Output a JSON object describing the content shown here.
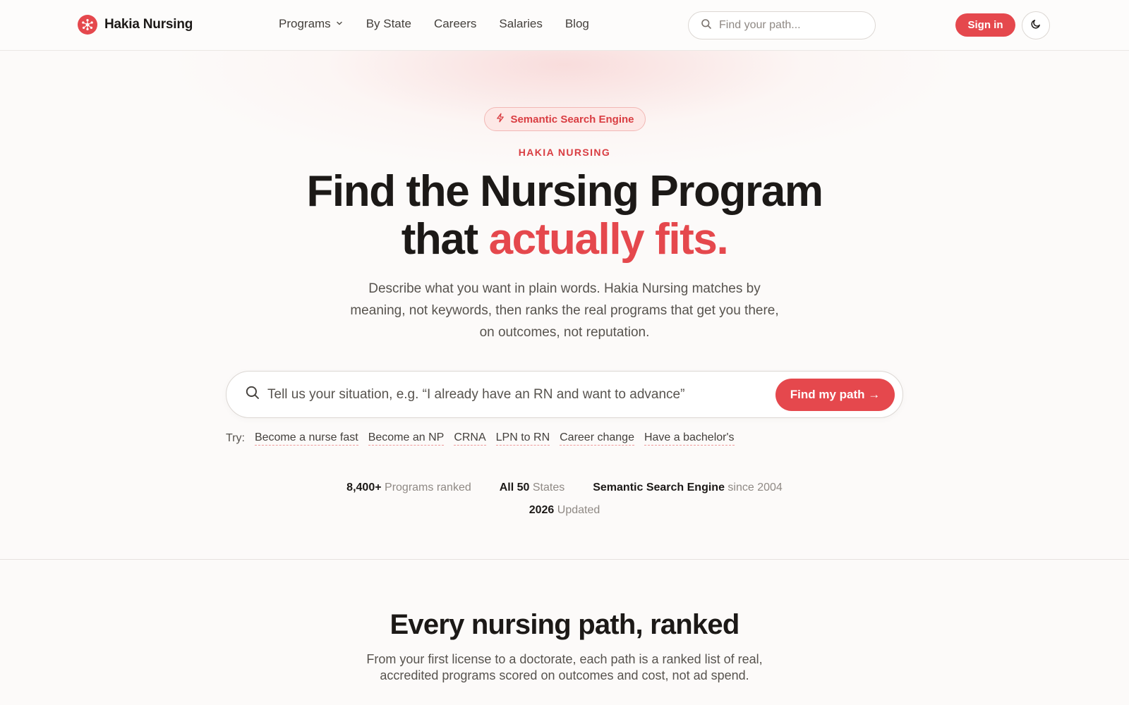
{
  "header": {
    "brand": "Hakia Nursing",
    "nav": [
      {
        "label": "Programs",
        "has_dropdown": true
      },
      {
        "label": "By State"
      },
      {
        "label": "Careers"
      },
      {
        "label": "Salaries"
      },
      {
        "label": "Blog"
      }
    ],
    "search_placeholder": "Find your path...",
    "signin_label": "Sign in",
    "theme_icon": "moon-icon"
  },
  "hero": {
    "badge": "Semantic Search Engine",
    "eyebrow": "HAKIA NURSING",
    "headline_line1": "Find the Nursing Program",
    "headline_line2_plain": "that ",
    "headline_line2_accent": "actually fits.",
    "subtext": "Describe what you want in plain words. Hakia Nursing matches by meaning, not keywords, then ranks the real programs that get you there, on outcomes, not reputation.",
    "search_placeholder": "Tell us your situation, e.g. “I already have an RN and want to advance”",
    "find_button": "Find my path →",
    "try_label": "Try:",
    "suggestions": [
      "Become a nurse fast",
      "Become an NP",
      "CRNA",
      "LPN to RN",
      "Career change",
      "Have a bachelor's"
    ],
    "stats": [
      {
        "value": "8,400+",
        "label": "Programs ranked"
      },
      {
        "value": "All 50",
        "label": "States"
      },
      {
        "value": "Semantic Search Engine",
        "label": "since 2004"
      },
      {
        "value": "2026",
        "label": "Updated"
      }
    ]
  },
  "section": {
    "title": "Every nursing path, ranked",
    "subtitle": "From your first license to a doctorate, each path is a ranked list of real, accredited programs scored on outcomes and cost, not ad spend."
  },
  "colors": {
    "accent": "#e5484d",
    "text": "#1c1917",
    "muted": "#57534e",
    "background": "#fcfaf9"
  }
}
